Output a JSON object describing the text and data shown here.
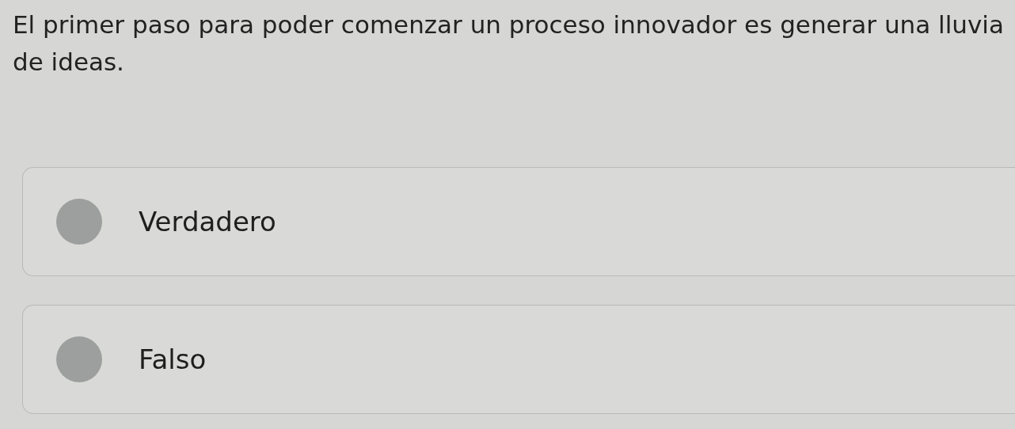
{
  "question": "El primer paso para poder comenzar un proceso innovador es generar una lluvia de ideas.",
  "options": [
    {
      "label": "Verdadero",
      "selected": false
    },
    {
      "label": "Falso",
      "selected": false
    }
  ]
}
